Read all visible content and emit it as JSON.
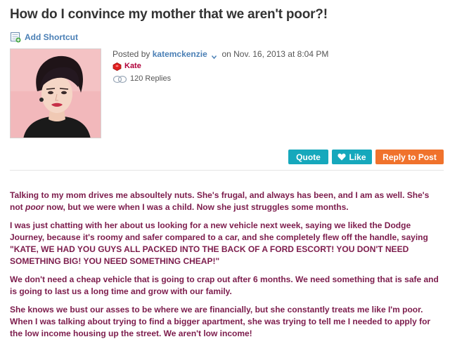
{
  "thread": {
    "title": "How do I convince my mother that we aren't poor?!"
  },
  "shortcut": {
    "label": "Add Shortcut",
    "icon": "add-shortcut-icon"
  },
  "post": {
    "posted_by_prefix": "Posted by",
    "author": "katemckenzie",
    "date_text": "on Nov. 16, 2013 at 8:04 PM",
    "badge_name": "Kate",
    "replies_text": "120 Replies"
  },
  "actions": {
    "quote_label": "Quote",
    "like_label": "Like",
    "reply_label": "Reply to Post"
  },
  "body": {
    "p1_before": "Talking to my mom drives me absoultely nuts. She's frugal, and always has been, and I am as well. She's not ",
    "p1_em": "poor",
    "p1_after": " now, but we were when I was a child. Now she just struggles some months.",
    "p2": "I was just chatting with her about us looking for a new vehicle next week, saying we liked the Dodge Journey, because it's roomy and safer compared to a car, and she completely flew off the handle, saying \"KATE, WE HAD YOU GUYS ALL PACKED INTO THE BACK OF A FORD ESCORT! YOU DON'T NEED SOMETHING BIG! YOU NEED SOMETHING CHEAP!\"",
    "p3": "We don't need a cheap vehicle that is going to crap out after 6 months. We need something that is safe and is going to last us a long time and grow with our family.",
    "p4": "She knows we bust our asses to be where we are financially, but she constantly treats me like I'm poor. When I was talking about trying to find a bigger apartment, she was trying to tell me I needed to apply for the low income housing up the street. We aren't low income!"
  },
  "colors": {
    "body_text": "#7c1c4c",
    "link": "#4a7fb5",
    "button_teal": "#16a8bc",
    "button_orange": "#f0722c",
    "badge_red": "#b0003a"
  }
}
